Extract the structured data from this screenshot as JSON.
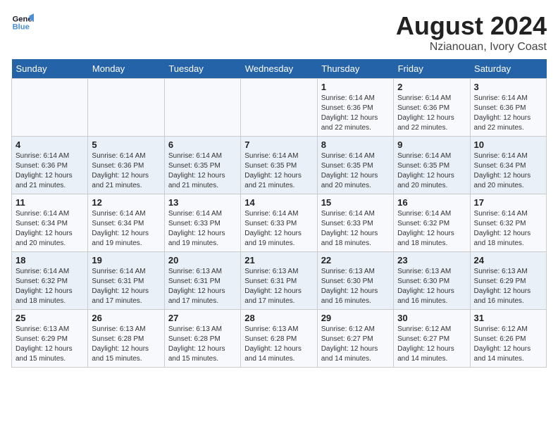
{
  "logo": {
    "line1": "General",
    "line2": "Blue"
  },
  "title": "August 2024",
  "subtitle": "Nzianouan, Ivory Coast",
  "days_of_week": [
    "Sunday",
    "Monday",
    "Tuesday",
    "Wednesday",
    "Thursday",
    "Friday",
    "Saturday"
  ],
  "weeks": [
    [
      {
        "day": "",
        "info": ""
      },
      {
        "day": "",
        "info": ""
      },
      {
        "day": "",
        "info": ""
      },
      {
        "day": "",
        "info": ""
      },
      {
        "day": "1",
        "info": "Sunrise: 6:14 AM\nSunset: 6:36 PM\nDaylight: 12 hours\nand 22 minutes."
      },
      {
        "day": "2",
        "info": "Sunrise: 6:14 AM\nSunset: 6:36 PM\nDaylight: 12 hours\nand 22 minutes."
      },
      {
        "day": "3",
        "info": "Sunrise: 6:14 AM\nSunset: 6:36 PM\nDaylight: 12 hours\nand 22 minutes."
      }
    ],
    [
      {
        "day": "4",
        "info": "Sunrise: 6:14 AM\nSunset: 6:36 PM\nDaylight: 12 hours\nand 21 minutes."
      },
      {
        "day": "5",
        "info": "Sunrise: 6:14 AM\nSunset: 6:36 PM\nDaylight: 12 hours\nand 21 minutes."
      },
      {
        "day": "6",
        "info": "Sunrise: 6:14 AM\nSunset: 6:35 PM\nDaylight: 12 hours\nand 21 minutes."
      },
      {
        "day": "7",
        "info": "Sunrise: 6:14 AM\nSunset: 6:35 PM\nDaylight: 12 hours\nand 21 minutes."
      },
      {
        "day": "8",
        "info": "Sunrise: 6:14 AM\nSunset: 6:35 PM\nDaylight: 12 hours\nand 20 minutes."
      },
      {
        "day": "9",
        "info": "Sunrise: 6:14 AM\nSunset: 6:35 PM\nDaylight: 12 hours\nand 20 minutes."
      },
      {
        "day": "10",
        "info": "Sunrise: 6:14 AM\nSunset: 6:34 PM\nDaylight: 12 hours\nand 20 minutes."
      }
    ],
    [
      {
        "day": "11",
        "info": "Sunrise: 6:14 AM\nSunset: 6:34 PM\nDaylight: 12 hours\nand 20 minutes."
      },
      {
        "day": "12",
        "info": "Sunrise: 6:14 AM\nSunset: 6:34 PM\nDaylight: 12 hours\nand 19 minutes."
      },
      {
        "day": "13",
        "info": "Sunrise: 6:14 AM\nSunset: 6:33 PM\nDaylight: 12 hours\nand 19 minutes."
      },
      {
        "day": "14",
        "info": "Sunrise: 6:14 AM\nSunset: 6:33 PM\nDaylight: 12 hours\nand 19 minutes."
      },
      {
        "day": "15",
        "info": "Sunrise: 6:14 AM\nSunset: 6:33 PM\nDaylight: 12 hours\nand 18 minutes."
      },
      {
        "day": "16",
        "info": "Sunrise: 6:14 AM\nSunset: 6:32 PM\nDaylight: 12 hours\nand 18 minutes."
      },
      {
        "day": "17",
        "info": "Sunrise: 6:14 AM\nSunset: 6:32 PM\nDaylight: 12 hours\nand 18 minutes."
      }
    ],
    [
      {
        "day": "18",
        "info": "Sunrise: 6:14 AM\nSunset: 6:32 PM\nDaylight: 12 hours\nand 18 minutes."
      },
      {
        "day": "19",
        "info": "Sunrise: 6:14 AM\nSunset: 6:31 PM\nDaylight: 12 hours\nand 17 minutes."
      },
      {
        "day": "20",
        "info": "Sunrise: 6:13 AM\nSunset: 6:31 PM\nDaylight: 12 hours\nand 17 minutes."
      },
      {
        "day": "21",
        "info": "Sunrise: 6:13 AM\nSunset: 6:31 PM\nDaylight: 12 hours\nand 17 minutes."
      },
      {
        "day": "22",
        "info": "Sunrise: 6:13 AM\nSunset: 6:30 PM\nDaylight: 12 hours\nand 16 minutes."
      },
      {
        "day": "23",
        "info": "Sunrise: 6:13 AM\nSunset: 6:30 PM\nDaylight: 12 hours\nand 16 minutes."
      },
      {
        "day": "24",
        "info": "Sunrise: 6:13 AM\nSunset: 6:29 PM\nDaylight: 12 hours\nand 16 minutes."
      }
    ],
    [
      {
        "day": "25",
        "info": "Sunrise: 6:13 AM\nSunset: 6:29 PM\nDaylight: 12 hours\nand 15 minutes."
      },
      {
        "day": "26",
        "info": "Sunrise: 6:13 AM\nSunset: 6:28 PM\nDaylight: 12 hours\nand 15 minutes."
      },
      {
        "day": "27",
        "info": "Sunrise: 6:13 AM\nSunset: 6:28 PM\nDaylight: 12 hours\nand 15 minutes."
      },
      {
        "day": "28",
        "info": "Sunrise: 6:13 AM\nSunset: 6:28 PM\nDaylight: 12 hours\nand 14 minutes."
      },
      {
        "day": "29",
        "info": "Sunrise: 6:12 AM\nSunset: 6:27 PM\nDaylight: 12 hours\nand 14 minutes."
      },
      {
        "day": "30",
        "info": "Sunrise: 6:12 AM\nSunset: 6:27 PM\nDaylight: 12 hours\nand 14 minutes."
      },
      {
        "day": "31",
        "info": "Sunrise: 6:12 AM\nSunset: 6:26 PM\nDaylight: 12 hours\nand 14 minutes."
      }
    ]
  ]
}
